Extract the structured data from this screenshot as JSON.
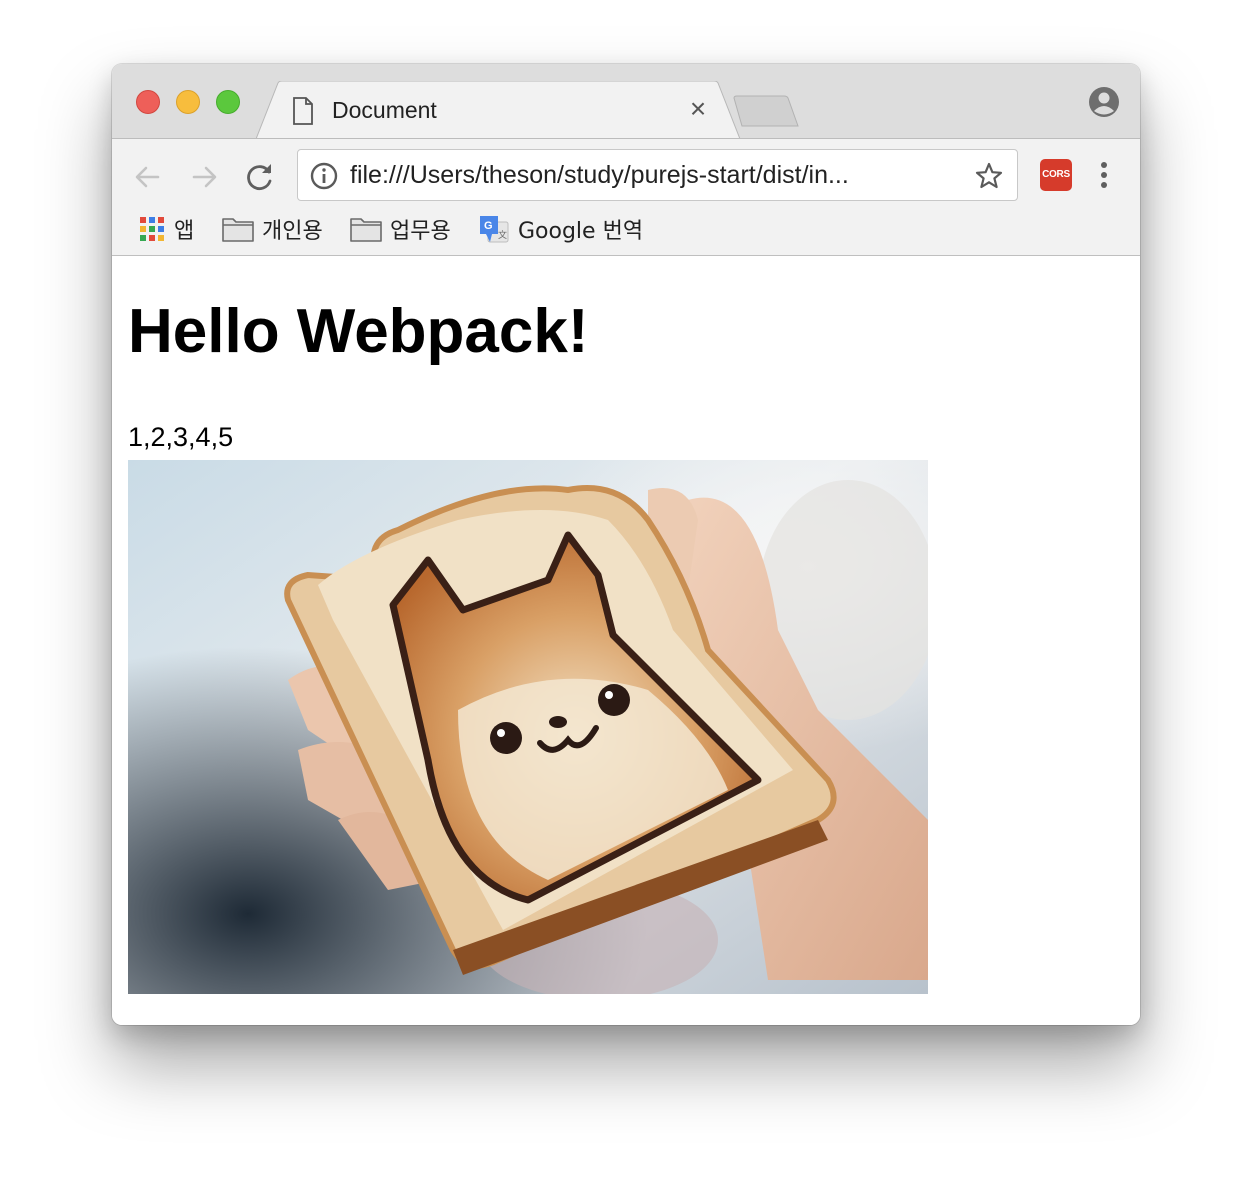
{
  "browser": {
    "tab": {
      "title": "Document",
      "close_symbol": "×"
    },
    "address_bar": {
      "url": "file:///Users/theson/study/purejs-start/dist/in..."
    },
    "extension": {
      "label": "CORS"
    },
    "bookmarks": [
      {
        "label": "앱",
        "icon": "apps-grid-icon"
      },
      {
        "label": "개인용",
        "icon": "folder-icon"
      },
      {
        "label": "업무용",
        "icon": "folder-icon"
      },
      {
        "label": "Google 번역",
        "icon": "google-translate-icon"
      }
    ]
  },
  "page": {
    "heading": "Hello Webpack!",
    "numbers_text": "1,2,3,4,5",
    "image_description": "shiba-toast-photo"
  },
  "colors": {
    "traffic_close": "#ee5f59",
    "traffic_minimize": "#f7bd3d",
    "traffic_maximize": "#5bc83d",
    "titlebar": "#dddddd",
    "toolbar": "#f2f2f2",
    "cors_badge": "#d63b2b"
  }
}
